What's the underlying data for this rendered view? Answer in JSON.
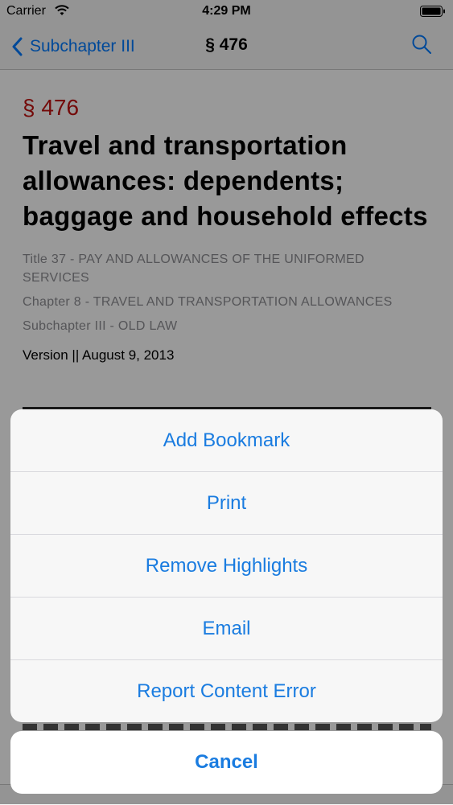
{
  "status_bar": {
    "carrier": "Carrier",
    "time": "4:29 PM",
    "wifi_icon": "wifi-icon",
    "battery_icon": "battery-icon"
  },
  "nav": {
    "back_label": "Subchapter III",
    "back_icon": "chevron-left-icon",
    "title": "§ 476",
    "search_icon": "search-icon"
  },
  "content": {
    "section_number": "§ 476",
    "title": "Travel and transportation allowances: dependents; baggage and household effects",
    "title_meta": "Title 37 - PAY AND ALLOWANCES OF THE UNIFORMED SERVICES",
    "chapter_meta": "Chapter 8 - TRAVEL AND TRANSPORTATION ALLOWANCES",
    "subchapter_meta": "Subchapter III - OLD LAW",
    "version": "Version || August 9, 2013"
  },
  "action_sheet": {
    "items": [
      {
        "label": "Add Bookmark"
      },
      {
        "label": "Print"
      },
      {
        "label": "Remove Highlights"
      },
      {
        "label": "Email"
      },
      {
        "label": "Report Content Error"
      }
    ],
    "cancel_label": "Cancel"
  },
  "colors": {
    "accent": "#1a7ce0",
    "section_red": "#c1120f",
    "meta_gray": "#8e8e93"
  }
}
